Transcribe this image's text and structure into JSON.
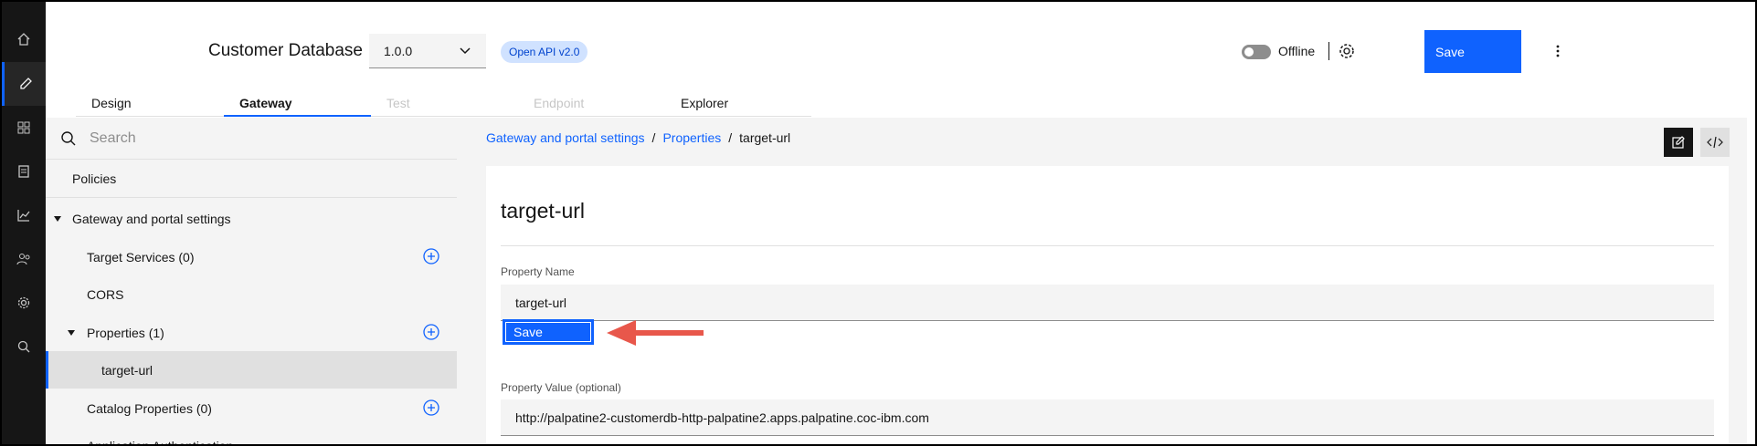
{
  "header": {
    "title": "Customer Database",
    "version": "1.0.0",
    "api_badge": "Open API v2.0",
    "offline_label": "Offline",
    "save_label": "Save"
  },
  "tabs": [
    {
      "label": "Design",
      "state": "normal"
    },
    {
      "label": "Gateway",
      "state": "selected"
    },
    {
      "label": "Test",
      "state": "disabled"
    },
    {
      "label": "Endpoint",
      "state": "disabled"
    },
    {
      "label": "Explorer",
      "state": "normal"
    }
  ],
  "sidebar": {
    "search_placeholder": "Search",
    "items": [
      {
        "label": "Policies"
      },
      {
        "label": "Gateway and portal settings"
      },
      {
        "label": "Target Services (0)"
      },
      {
        "label": "CORS"
      },
      {
        "label": "Properties (1)"
      },
      {
        "label": "target-url"
      },
      {
        "label": "Catalog Properties (0)"
      },
      {
        "label": "Application Authentication"
      }
    ]
  },
  "breadcrumb": {
    "items": [
      "Gateway and portal settings",
      "Properties",
      "target-url"
    ],
    "separator": "/"
  },
  "detail": {
    "title": "target-url",
    "property_name_label": "Property Name",
    "property_name_value": "target-url",
    "inline_save_label": "Save",
    "property_value_label": "Property Value (optional)",
    "property_value_value": "http://palpatine2-customerdb-http-palpatine2.apps.palpatine.coc-ibm.com"
  },
  "colors": {
    "primary": "#0f62fe",
    "rail": "#161616",
    "annotation_arrow": "#e8574b"
  },
  "icons": {
    "rail": [
      "home-icon",
      "edit-icon",
      "apps-icon",
      "document-icon",
      "analytics-icon",
      "users-icon",
      "settings-icon",
      "search-icon"
    ]
  }
}
